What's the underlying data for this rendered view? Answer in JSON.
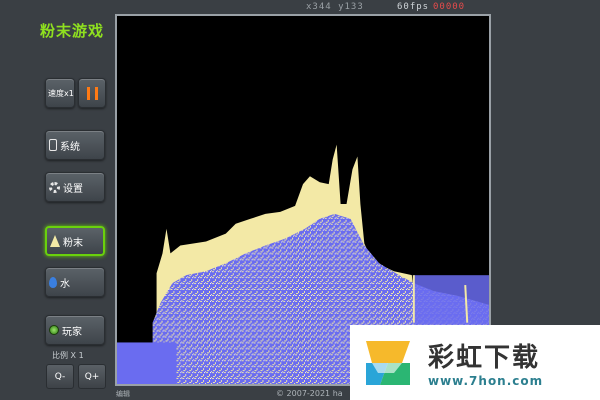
{
  "app": {
    "title": "粉末游戏"
  },
  "hud": {
    "coords": "x344 y133",
    "fps": "60fps",
    "particles": "00000"
  },
  "controls": {
    "speed_label": "速度x1",
    "system_label": "系统",
    "settings_label": "设置",
    "powder_label": "粉末",
    "water_label": "水",
    "player_label": "玩家",
    "scale_label": "比例 X 1",
    "zoom_out_label": "Q-",
    "zoom_in_label": "Q+"
  },
  "footer": {
    "left": "编辑",
    "copyright": "© 2007-2021 ha"
  },
  "watermark": {
    "title": "彩虹下载",
    "url": "www.7hon.com"
  },
  "colors": {
    "accent": "#8fe01f",
    "pause": "#ff7a14",
    "powder": "#f3e9a6",
    "water": "#6a6cf0",
    "canvas_bg": "#000000"
  }
}
